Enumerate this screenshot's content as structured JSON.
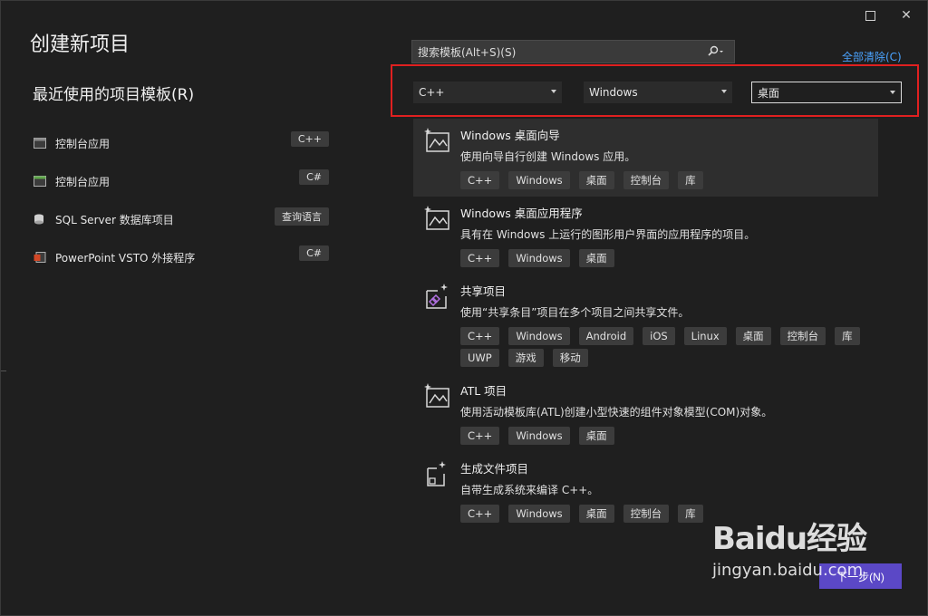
{
  "window": {
    "title": "创建新项目"
  },
  "recent": {
    "title": "最近使用的项目模板(R)",
    "items": [
      {
        "label": "控制台应用",
        "tag": "C++",
        "icon": "console-app-icon"
      },
      {
        "label": "控制台应用",
        "tag": "C#",
        "icon": "console-app-icon"
      },
      {
        "label": "SQL Server 数据库项目",
        "tag": "查询语言",
        "icon": "database-project-icon"
      },
      {
        "label": "PowerPoint VSTO 外接程序",
        "tag": "C#",
        "icon": "powerpoint-addin-icon"
      }
    ]
  },
  "search": {
    "placeholder": "搜索模板(Alt+S)(S)"
  },
  "clear_all": "全部清除(C)",
  "filters": {
    "language": "C++",
    "platform": "Windows",
    "project_type": "桌面"
  },
  "templates": [
    {
      "name": "Windows 桌面向导",
      "desc": "使用向导自行创建 Windows 应用。",
      "tags": [
        "C++",
        "Windows",
        "桌面",
        "控制台",
        "库"
      ],
      "icon": "desktop-wizard-icon"
    },
    {
      "name": "Windows 桌面应用程序",
      "desc": "具有在 Windows 上运行的图形用户界面的应用程序的项目。",
      "tags": [
        "C++",
        "Windows",
        "桌面"
      ],
      "icon": "desktop-app-icon"
    },
    {
      "name": "共享项目",
      "desc": "使用“共享条目”项目在多个项目之间共享文件。",
      "tags": [
        "C++",
        "Windows",
        "Android",
        "iOS",
        "Linux",
        "桌面",
        "控制台",
        "库",
        "UWP",
        "游戏",
        "移动"
      ],
      "icon": "shared-project-icon"
    },
    {
      "name": "ATL 项目",
      "desc": "使用活动模板库(ATL)创建小型快速的组件对象模型(COM)对象。",
      "tags": [
        "C++",
        "Windows",
        "桌面"
      ],
      "icon": "atl-project-icon"
    },
    {
      "name": "生成文件项目",
      "desc": "自带生成系统来编译 C++。",
      "tags": [
        "C++",
        "Windows",
        "桌面",
        "控制台",
        "库"
      ],
      "icon": "makefile-project-icon"
    }
  ],
  "next_button": "下一步(N)",
  "watermark": {
    "top": "Baidu经验",
    "bottom": "jingyan.baidu.com"
  },
  "colors": {
    "background": "#1f1f1f",
    "accent": "#5b48c6",
    "highlight_border": "#e02020",
    "link": "#4aa3ff"
  }
}
